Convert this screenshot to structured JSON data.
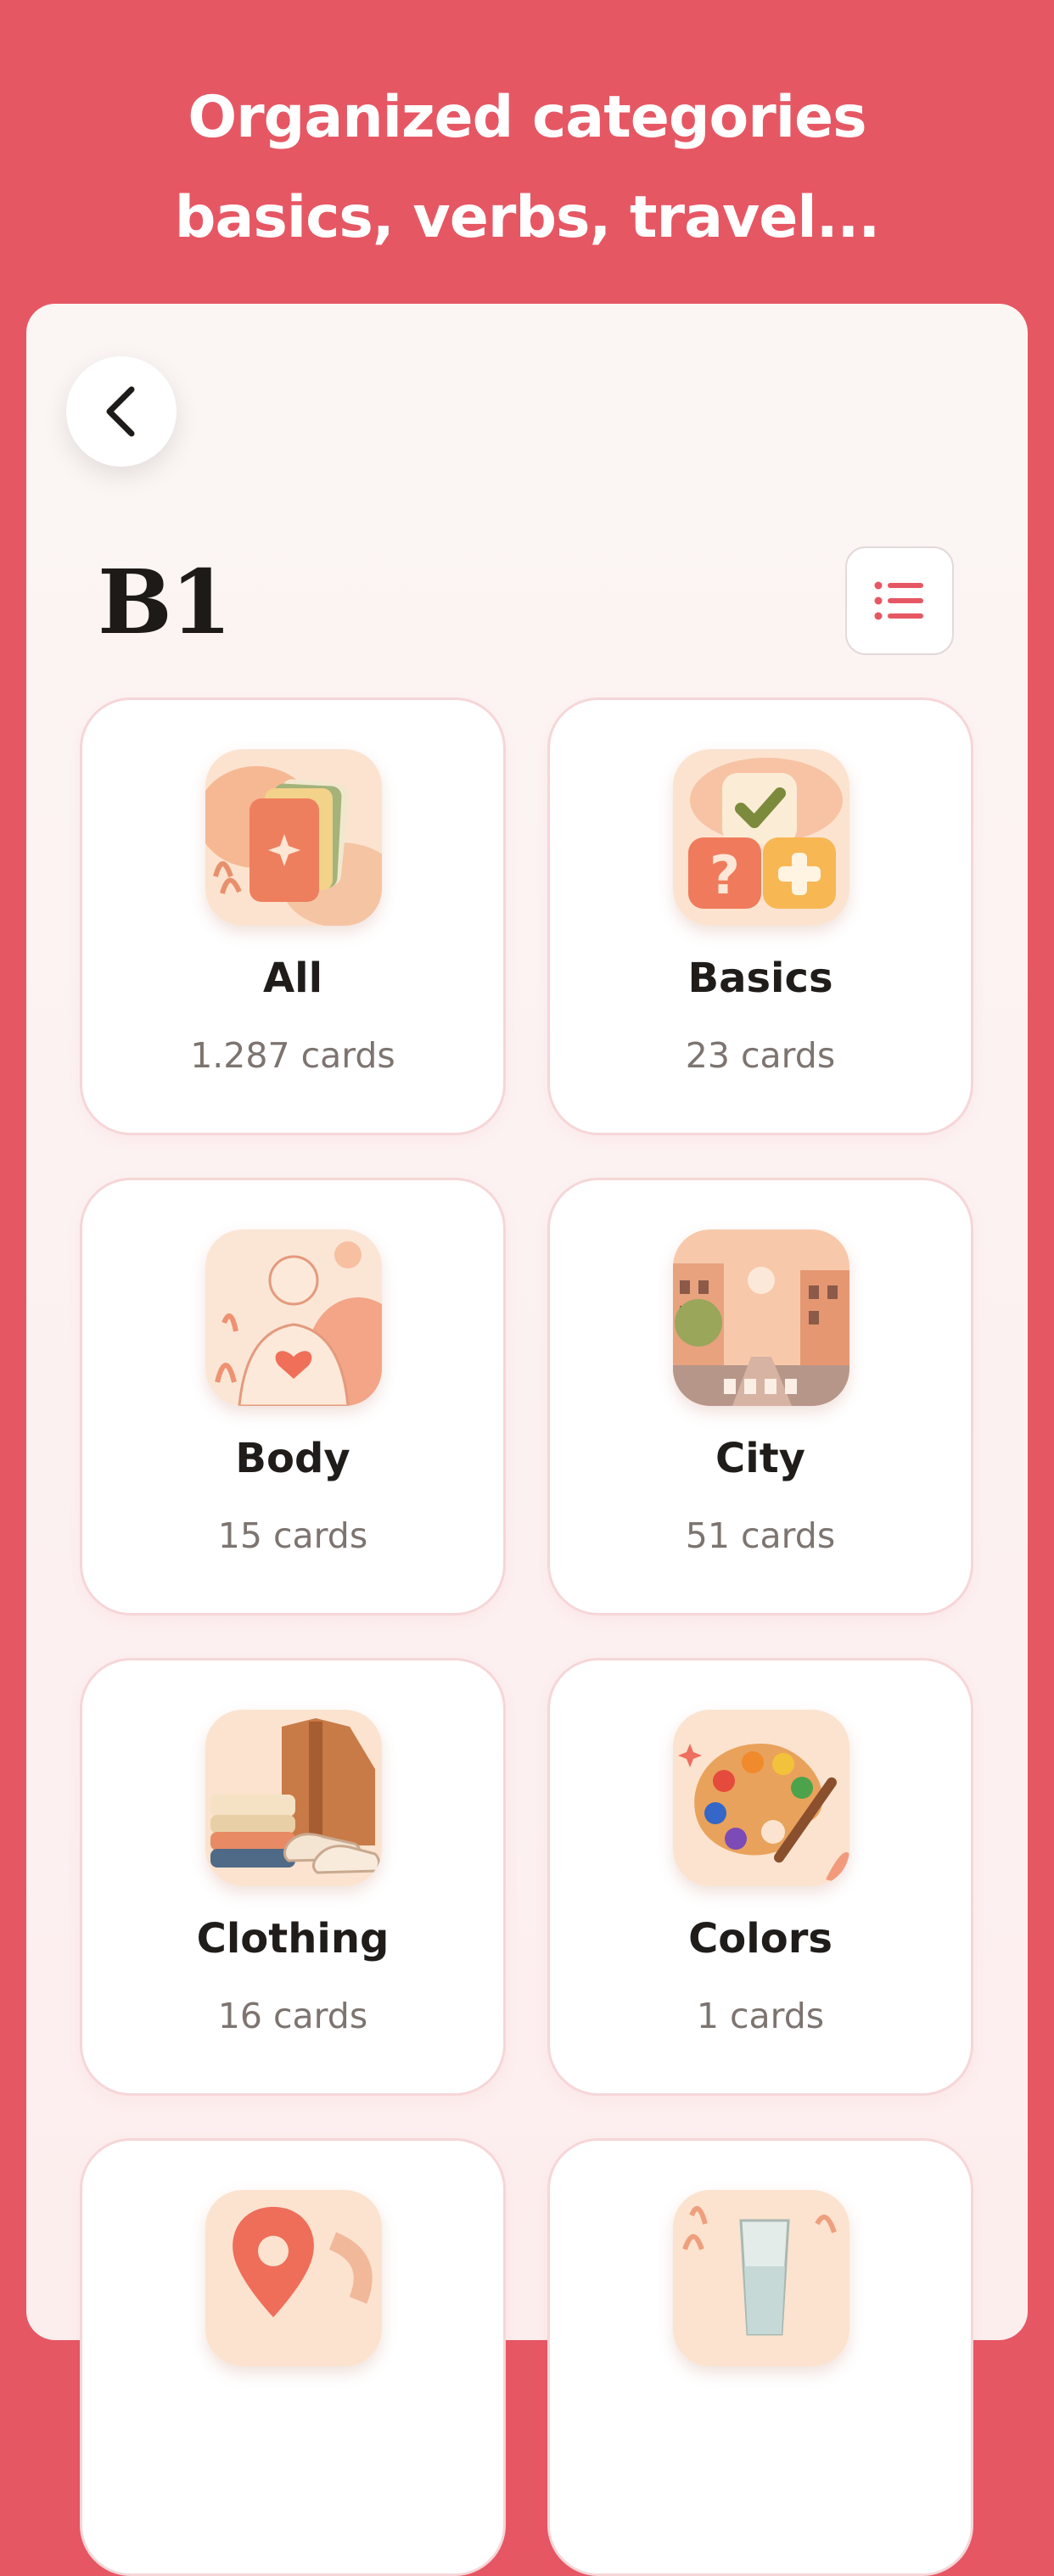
{
  "headline": {
    "line1": "Organized categories",
    "line2": "basics, verbs, travel..."
  },
  "header": {
    "level": "B1"
  },
  "colors": {
    "brand_red": "#e65764",
    "card_border": "#f6d6d8",
    "text_dark": "#1f1c1a",
    "text_muted": "#7d7470"
  },
  "categories": [
    {
      "name": "All",
      "count": "1.287 cards",
      "icon": "stacked-cards-icon"
    },
    {
      "name": "Basics",
      "count": "23 cards",
      "icon": "checkmark-question-plus-icon"
    },
    {
      "name": "Body",
      "count": "15 cards",
      "icon": "body-heart-icon"
    },
    {
      "name": "City",
      "count": "51 cards",
      "icon": "city-street-icon"
    },
    {
      "name": "Clothing",
      "count": "16 cards",
      "icon": "clothing-icon"
    },
    {
      "name": "Colors",
      "count": "1 cards",
      "icon": "paint-palette-icon"
    },
    {
      "name": "",
      "count": "",
      "icon": "location-pin-icon"
    },
    {
      "name": "",
      "count": "",
      "icon": "water-glass-icon"
    }
  ]
}
